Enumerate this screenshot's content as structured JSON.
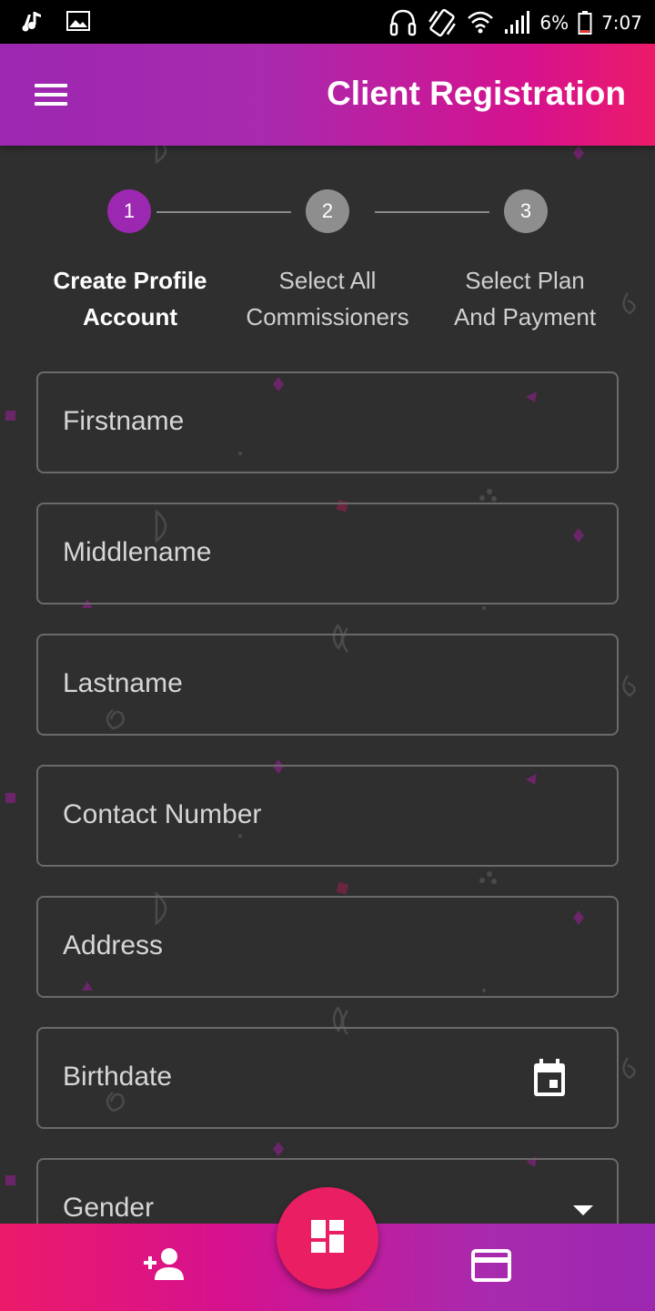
{
  "status_bar": {
    "battery_percent": "6%",
    "time": "7:07",
    "icons": [
      "music-note-icon",
      "image-icon",
      "headset-icon",
      "vibrate-icon",
      "wifi-icon",
      "signal-icon",
      "battery-low-icon"
    ]
  },
  "app_bar": {
    "title": "Client Registration",
    "menu_icon": "hamburger-menu-icon"
  },
  "stepper": {
    "current_step": 1,
    "steps": [
      {
        "number": "1",
        "label_line1": "Create Profile",
        "label_line2": "Account",
        "state": "active"
      },
      {
        "number": "2",
        "label_line1": "Select All",
        "label_line2": "Commissioners",
        "state": "inactive"
      },
      {
        "number": "3",
        "label_line1": "Select Plan",
        "label_line2": "And Payment",
        "state": "inactive"
      }
    ]
  },
  "form": {
    "fields": [
      {
        "label": "Firstname",
        "value": ""
      },
      {
        "label": "Middlename",
        "value": ""
      },
      {
        "label": "Lastname",
        "value": ""
      },
      {
        "label": "Contact Number",
        "value": ""
      },
      {
        "label": "Address",
        "value": ""
      },
      {
        "label": "Birthdate",
        "value": "",
        "trailing_icon": "calendar-icon"
      },
      {
        "label": "Gender",
        "value": "",
        "trailing_icon": "dropdown-arrow-icon"
      }
    ]
  },
  "bottom_nav": {
    "left_icon": "add-person-icon",
    "center_icon": "dashboard-icon",
    "right_icon": "credit-card-icon"
  },
  "colors": {
    "primary_purple": "#9c27b0",
    "accent_pink": "#e91e63",
    "background": "#2f2f2f",
    "inactive_step": "#8e8e8e"
  }
}
